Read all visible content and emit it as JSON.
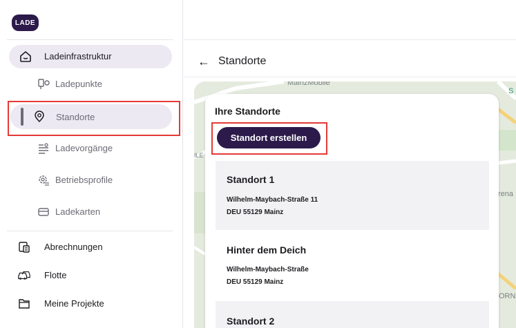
{
  "logo": {
    "text": "LADE"
  },
  "sidebar": {
    "parent": {
      "label": "Ladeinfrastruktur",
      "icon": "home-icon"
    },
    "sub_items": [
      {
        "label": "Ladepunkte",
        "icon": "charger-icon"
      },
      {
        "label": "Standorte",
        "icon": "location-pin-icon",
        "active": true
      },
      {
        "label": "Ladevorgänge",
        "icon": "charging-sessions-icon"
      },
      {
        "label": "Betriebsprofile",
        "icon": "gear-profile-icon"
      },
      {
        "label": "Ladekarten",
        "icon": "card-icon"
      }
    ],
    "items": [
      {
        "label": "Abrechnungen",
        "icon": "billing-icon"
      },
      {
        "label": "Flotte",
        "icon": "fleet-car-icon"
      },
      {
        "label": "Meine Projekte",
        "icon": "folder-icon"
      }
    ]
  },
  "header": {
    "back_icon": "arrow-left-icon",
    "title": "Standorte"
  },
  "map": {
    "labels": [
      "MainzMobile",
      "S",
      "HLE",
      "rena",
      "ORNE"
    ]
  },
  "panel": {
    "heading": "Ihre Standorte",
    "create_button": "Standort erstellen",
    "locations": [
      {
        "name": "Standort 1",
        "address_line1": "Wilhelm-Maybach-Straße 11",
        "address_line2": "DEU 55129 Mainz"
      },
      {
        "name": "Hinter dem Deich",
        "address_line1": "Wilhelm-Maybach-Straße",
        "address_line2": "DEU 55129 Mainz"
      },
      {
        "name": "Standort 2",
        "address_line1": "",
        "address_line2": ""
      }
    ]
  },
  "colors": {
    "brand": "#2b1a4a",
    "highlight": "#e53935",
    "active_bg": "#ede9f3"
  }
}
